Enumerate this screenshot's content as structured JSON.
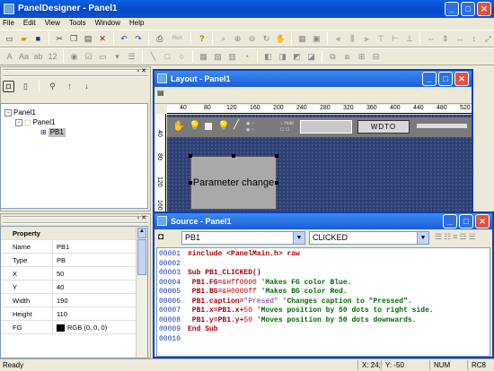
{
  "app": {
    "title": "PanelDesigner - Panel1"
  },
  "menu": [
    "File",
    "Edit",
    "View",
    "Tools",
    "Window",
    "Help"
  ],
  "window_buttons": {
    "minimize": "_",
    "maximize": "□",
    "close": "✕"
  },
  "toolbar": {
    "run_label": "Run"
  },
  "tree": {
    "items": [
      {
        "label": "Panel1"
      },
      {
        "label": "Panel1"
      },
      {
        "label": "PB1"
      }
    ]
  },
  "properties": {
    "header": "Property",
    "rows": [
      {
        "key": "Name",
        "value": "PB1"
      },
      {
        "key": "Type",
        "value": "PB"
      },
      {
        "key": "X",
        "value": "50"
      },
      {
        "key": "Y",
        "value": "40"
      },
      {
        "key": "Width",
        "value": "190"
      },
      {
        "key": "Height",
        "value": "110"
      },
      {
        "key": "FG",
        "value": "RGB (0, 0, 0)"
      }
    ]
  },
  "layout_window": {
    "title": "Layout - Panel1",
    "ruler_h": [
      "40",
      "80",
      "120",
      "160",
      "200",
      "240",
      "280",
      "320",
      "360",
      "400",
      "440",
      "480",
      "520"
    ],
    "ruler_v": [
      "40",
      "80",
      "120",
      "160"
    ],
    "button_label": "Parameter change",
    "widget_label": "WDTO",
    "widget_text": "Hold"
  },
  "source_window": {
    "title": "Source - Panel1",
    "object_combo": "PB1",
    "event_combo": "CLICKED",
    "lines": [
      {
        "no": "00001",
        "text": "#include <PanelMain.h> raw"
      },
      {
        "no": "00002",
        "text": ""
      },
      {
        "no": "00003",
        "text": "Sub PB1_CLICKED()"
      },
      {
        "no": "00004",
        "text": " PB1.FG=&Hff0000 'Makes FG color Blue."
      },
      {
        "no": "00005",
        "text": " PB1.BG=&H0000ff 'Makes BG color Red."
      },
      {
        "no": "00006",
        "text": " PB1.caption=\"Presed\" 'Changes caption to \"Pressed\"."
      },
      {
        "no": "00007",
        "text": " PB1.x=PB1.x+50 'Moves position by 50 dots to right side."
      },
      {
        "no": "00008",
        "text": " PB1.y=PB1.y+50 'Moves position by 50 dots downwards."
      },
      {
        "no": "00009",
        "text": "End Sub"
      },
      {
        "no": "00010",
        "text": ""
      }
    ]
  },
  "status": {
    "left": "Ready",
    "x": "X: 24;",
    "y": "Y: -50",
    "num": "NUM",
    "rc": "RC8"
  }
}
